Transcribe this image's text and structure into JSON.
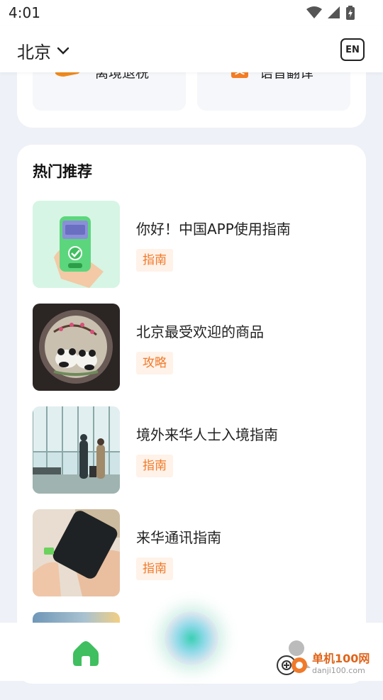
{
  "status_bar": {
    "time": "4:01",
    "icons": [
      "wifi-icon",
      "signal-icon",
      "battery-icon"
    ]
  },
  "header": {
    "city": "北京",
    "lang_button": "EN"
  },
  "quick_actions": [
    {
      "label": "离境退税",
      "icon": "tax-refund-icon"
    },
    {
      "label": "语音翻译",
      "icon": "translate-icon"
    }
  ],
  "recommend": {
    "title": "热门推荐",
    "items": [
      {
        "title": "你好！中国APP使用指南",
        "tag": "指南"
      },
      {
        "title": "北京最受欢迎的商品",
        "tag": "攻略"
      },
      {
        "title": "境外来华人士入境指南",
        "tag": "指南"
      },
      {
        "title": "来华通讯指南",
        "tag": "指南"
      }
    ]
  },
  "watermark": {
    "name": "单机100网",
    "url": "danji100.com"
  },
  "colors": {
    "accent": "#f07a2a",
    "tag_bg": "#fff2e9",
    "home_green": "#3fbf5f",
    "page_bg": "#eef1f7"
  }
}
